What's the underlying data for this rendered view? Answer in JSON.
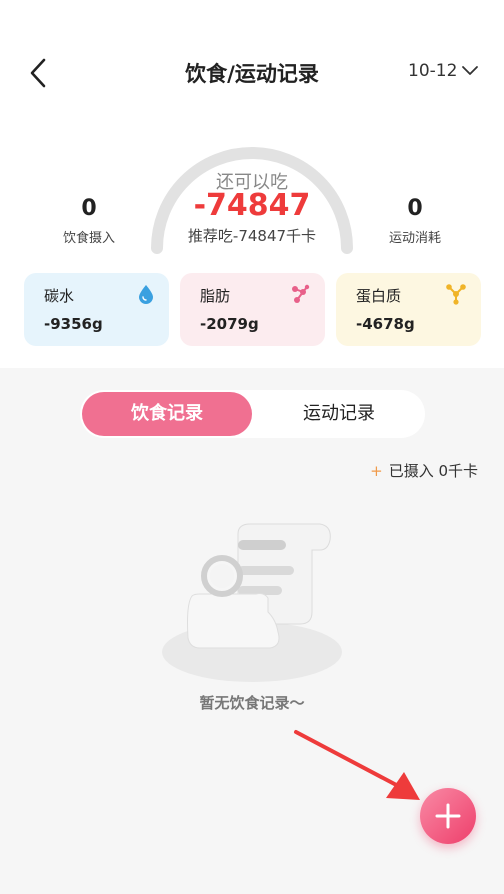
{
  "header": {
    "title": "饮食/运动记录",
    "date": "10-12",
    "back_icon": "chevron-left-icon",
    "date_icon": "chevron-down-icon"
  },
  "summary": {
    "intake": {
      "value": "0",
      "label": "饮食摄入"
    },
    "burned": {
      "value": "0",
      "label": "运动消耗"
    },
    "remaining_label": "还可以吃",
    "remaining_value": "-74847",
    "recommend": "推荐吃-74847千卡",
    "gauge_fill": 0
  },
  "nutrients": [
    {
      "label": "碳水",
      "value": "-9356g",
      "icon": "water-drop-icon",
      "color": "#3aa0e0"
    },
    {
      "label": "脂肪",
      "value": "-2079g",
      "icon": "molecule-icon",
      "color": "#e8608a"
    },
    {
      "label": "蛋白质",
      "value": "-4678g",
      "icon": "molecule-icon",
      "color": "#f0b428"
    }
  ],
  "tabs": [
    {
      "label": "饮食记录",
      "active": true
    },
    {
      "label": "运动记录",
      "active": false
    }
  ],
  "intake": {
    "plus": "+",
    "text": "已摄入 0千卡"
  },
  "empty": {
    "text": "暂无饮食记录～"
  },
  "colors": {
    "accent": "#f07091",
    "remaining": "#ee3b3b",
    "panel": "#f6f6f6"
  }
}
